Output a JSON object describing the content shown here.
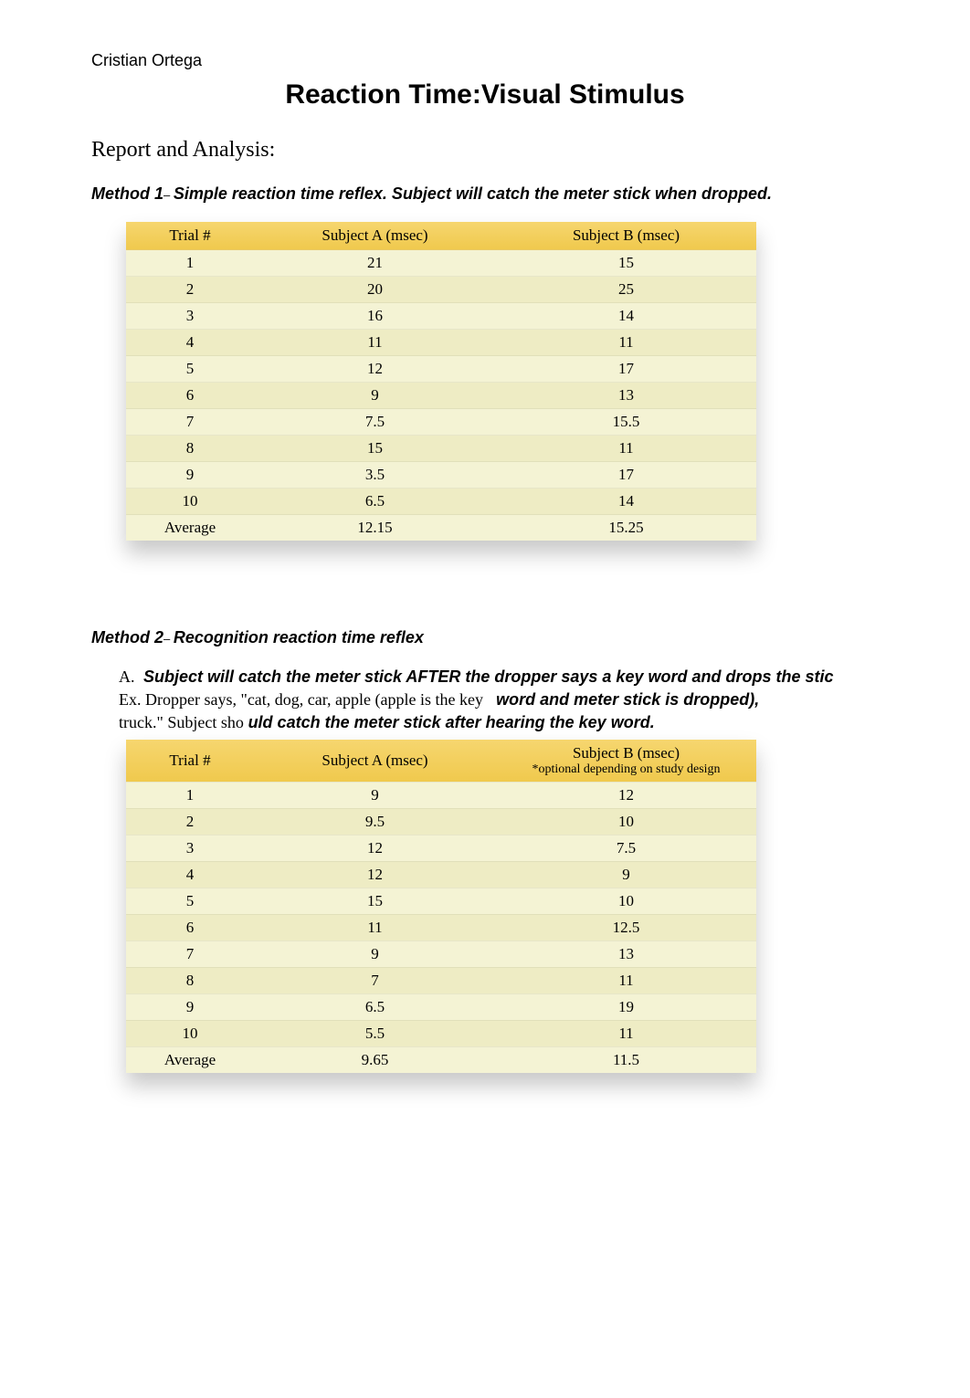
{
  "author": "Cristian Ortega",
  "title": "Reaction Time:Visual Stimulus",
  "section_heading": "Report and Analysis:",
  "method1": {
    "prefix": "Method 1",
    "dash": "– ",
    "desc": "Simple reaction time reflex. Subject will catch the meter stick when dropped.",
    "headers": {
      "trial": "Trial #",
      "a": "Subject A (msec)",
      "b": "Subject B (msec)"
    },
    "rows": [
      {
        "trial": "1",
        "a": "21",
        "b": "15"
      },
      {
        "trial": "2",
        "a": "20",
        "b": "25"
      },
      {
        "trial": "3",
        "a": "16",
        "b": "14"
      },
      {
        "trial": "4",
        "a": "11",
        "b": "11"
      },
      {
        "trial": "5",
        "a": "12",
        "b": "17"
      },
      {
        "trial": "6",
        "a": "9",
        "b": "13"
      },
      {
        "trial": "7",
        "a": "7.5",
        "b": "15.5"
      },
      {
        "trial": "8",
        "a": "15",
        "b": "11"
      },
      {
        "trial": "9",
        "a": "3.5",
        "b": "17"
      },
      {
        "trial": "10",
        "a": "6.5",
        "b": "14"
      },
      {
        "trial": "Average",
        "a": "12.15",
        "b": "15.25"
      }
    ]
  },
  "method2": {
    "prefix": "Method 2",
    "dash": "– ",
    "desc": "Recognition reaction time reflex",
    "sub_letter": "A.",
    "sub_bold1": "Subject will catch the meter stick AFTER the dropper says a key word and drops the stic",
    "sub_plain1": "Ex. Dropper says, \"cat, dog, car, apple (apple is the key",
    "sub_bold2": "word and meter stick is dropped),",
    "sub_plain2": "truck.\" Subject sho",
    "sub_bold3": "uld catch the meter stick after hearing the key word.",
    "headers": {
      "trial": "Trial #",
      "a": "Subject A (msec)",
      "b": "Subject B (msec)",
      "b_note": "*optional depending on study design"
    },
    "rows": [
      {
        "trial": "1",
        "a": "9",
        "b": "12"
      },
      {
        "trial": "2",
        "a": "9.5",
        "b": "10"
      },
      {
        "trial": "3",
        "a": "12",
        "b": "7.5"
      },
      {
        "trial": "4",
        "a": "12",
        "b": "9"
      },
      {
        "trial": "5",
        "a": "15",
        "b": "10"
      },
      {
        "trial": "6",
        "a": "11",
        "b": "12.5"
      },
      {
        "trial": "7",
        "a": "9",
        "b": "13"
      },
      {
        "trial": "8",
        "a": "7",
        "b": "11"
      },
      {
        "trial": "9",
        "a": "6.5",
        "b": "19"
      },
      {
        "trial": "10",
        "a": "5.5",
        "b": "11"
      },
      {
        "trial": "Average",
        "a": "9.65",
        "b": "11.5"
      }
    ]
  },
  "chart_data": [
    {
      "type": "table",
      "title": "Method 1 – Simple reaction time reflex",
      "columns": [
        "Trial #",
        "Subject A (msec)",
        "Subject B (msec)"
      ],
      "rows": [
        [
          "1",
          21,
          15
        ],
        [
          "2",
          20,
          25
        ],
        [
          "3",
          16,
          14
        ],
        [
          "4",
          11,
          11
        ],
        [
          "5",
          12,
          17
        ],
        [
          "6",
          9,
          13
        ],
        [
          "7",
          7.5,
          15.5
        ],
        [
          "8",
          15,
          11
        ],
        [
          "9",
          3.5,
          17
        ],
        [
          "10",
          6.5,
          14
        ],
        [
          "Average",
          12.15,
          15.25
        ]
      ]
    },
    {
      "type": "table",
      "title": "Method 2A – Recognition reaction time reflex (key word)",
      "columns": [
        "Trial #",
        "Subject A (msec)",
        "Subject B (msec)"
      ],
      "rows": [
        [
          "1",
          9,
          12
        ],
        [
          "2",
          9.5,
          10
        ],
        [
          "3",
          12,
          7.5
        ],
        [
          "4",
          12,
          9
        ],
        [
          "5",
          15,
          10
        ],
        [
          "6",
          11,
          12.5
        ],
        [
          "7",
          9,
          13
        ],
        [
          "8",
          7,
          11
        ],
        [
          "9",
          6.5,
          19
        ],
        [
          "10",
          5.5,
          11
        ],
        [
          "Average",
          9.65,
          11.5
        ]
      ]
    }
  ]
}
